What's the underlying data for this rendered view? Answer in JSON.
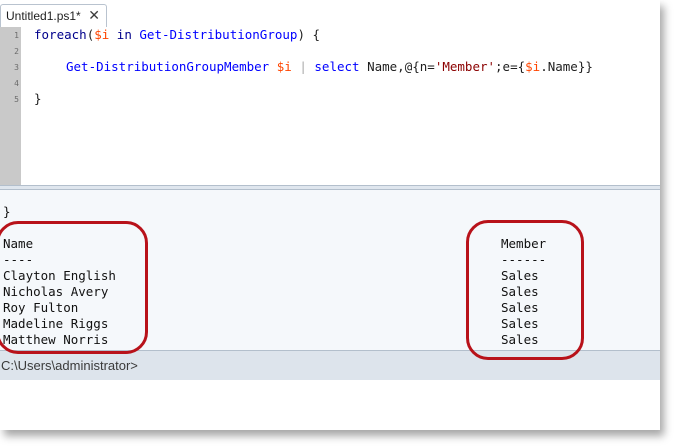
{
  "tab": {
    "title": "Untitled1.ps1*",
    "close_glyph": "✕"
  },
  "editor": {
    "line_numbers": [
      "1",
      "2",
      "3",
      "4",
      "5"
    ],
    "line1": {
      "kw": "foreach",
      "p1": "(",
      "var": "$i",
      "mid": " in ",
      "cmd": "Get-DistributionGroup",
      "p2": ") {"
    },
    "line3": {
      "cmd1": "Get-DistributionGroupMember",
      "sp1": " ",
      "var1": "$i",
      "sp2": " ",
      "pipe": "|",
      "sp3": " ",
      "cmd2": "select",
      "arg": " Name,@{n=",
      "str": "'Member'",
      "mid": ";e={",
      "var2": "$i",
      "tail": ".Name}}"
    },
    "line5": "}"
  },
  "output": {
    "closing_brace": "}",
    "col1_header": "Name",
    "col1_rule": "----",
    "col2_header": "Member",
    "col2_rule": "------",
    "rows": [
      {
        "name": "Clayton English",
        "member": "Sales"
      },
      {
        "name": "Nicholas Avery",
        "member": "Sales"
      },
      {
        "name": "Roy Fulton",
        "member": "Sales"
      },
      {
        "name": "Madeline Riggs",
        "member": "Sales"
      },
      {
        "name": "Matthew Norris",
        "member": "Sales"
      }
    ]
  },
  "console": {
    "prompt": "C:\\Users\\administrator>"
  },
  "colors": {
    "annotation": "#b8121a",
    "keyword": "#00008b",
    "cmdlet": "#0000ff",
    "variable": "#ff4500",
    "string": "#8b0000"
  }
}
